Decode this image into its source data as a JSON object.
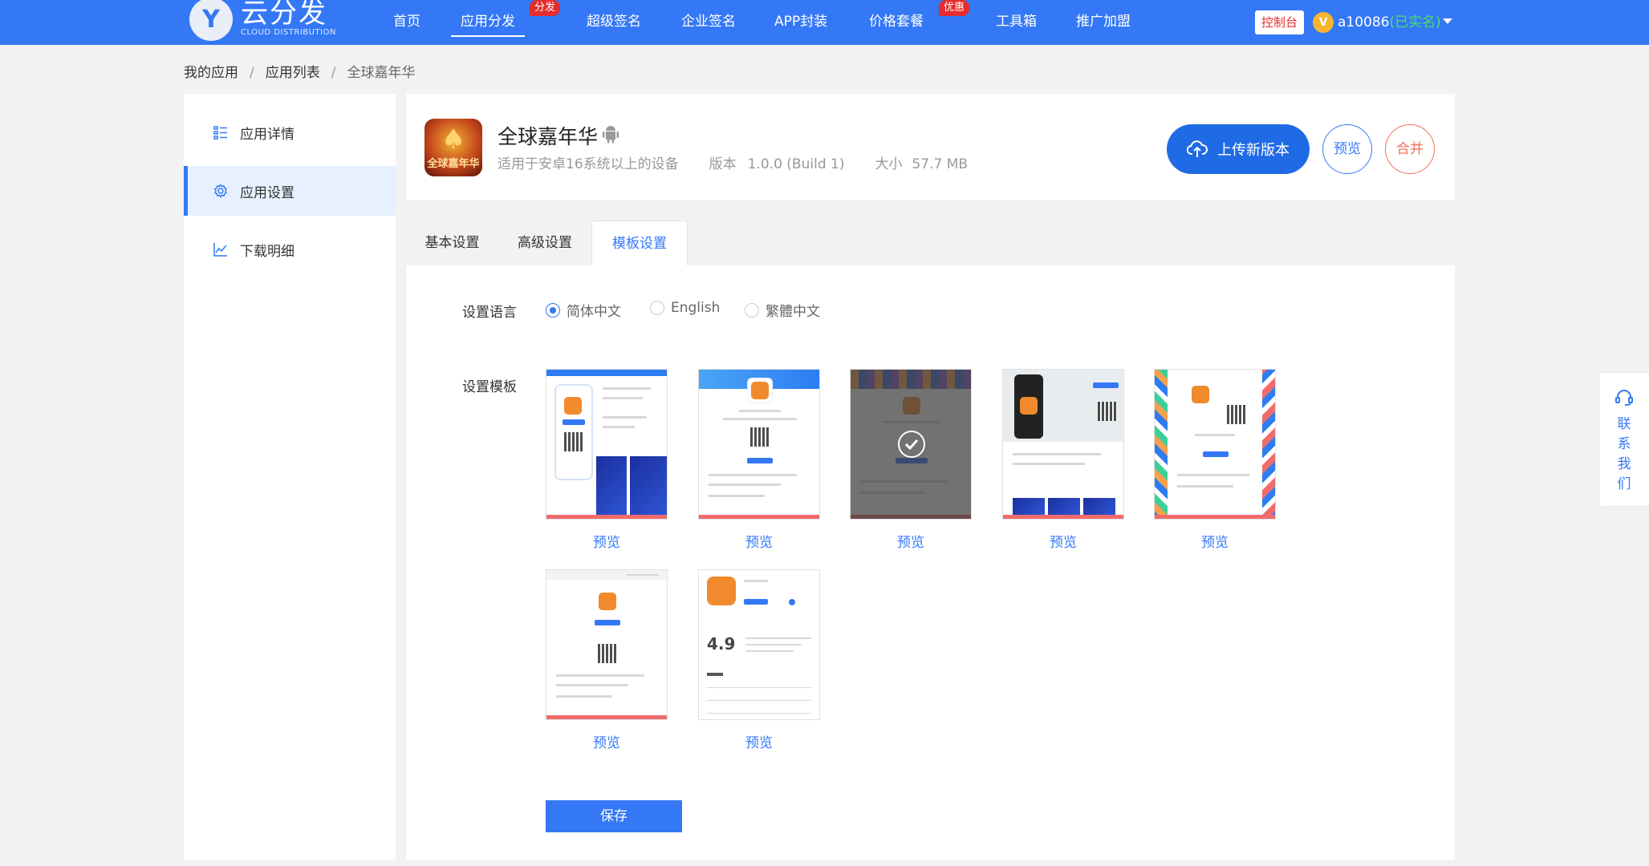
{
  "brand": {
    "logo_letter": "Y",
    "name_cn": "云分发",
    "name_en": "CLOUD DISTRIBUTION"
  },
  "nav": {
    "items": [
      "首页",
      "应用分发",
      "超级签名",
      "企业签名",
      "APP封装",
      "价格套餐",
      "工具箱",
      "推广加盟"
    ],
    "badge_distribute": "分发",
    "badge_price": "优惠",
    "active": "应用分发"
  },
  "user": {
    "console_label": "控制台",
    "vip_letter": "V",
    "name": "a10086",
    "status": "(已实名)"
  },
  "breadcrumb": {
    "root": "我的应用",
    "list": "应用列表",
    "current": "全球嘉年华",
    "sep": "/"
  },
  "sidebar": {
    "items": [
      "应用详情",
      "应用设置",
      "下载明细"
    ],
    "active": "应用设置"
  },
  "app": {
    "name": "全球嘉年华",
    "icon_text": "全球嘉年华",
    "icon_glyph": "♠",
    "compat": "适用于安卓16系统以上的设备",
    "version_label": "版本",
    "version": "1.0.0 (Build 1)",
    "size_label": "大小",
    "size": "57.7 MB",
    "upload_label": "上传新版本",
    "preview_label": "预览",
    "merge_label": "合并"
  },
  "tabs": [
    "基本设置",
    "高级设置",
    "模板设置"
  ],
  "tabs_active": "模板设置",
  "settings": {
    "language_label": "设置语言",
    "languages": [
      "简体中文",
      "English",
      "繁體中文"
    ],
    "language_selected": "简体中文",
    "template_label": "设置模板",
    "preview_link": "预览",
    "template_count": 7,
    "template_selected_index": 3,
    "save_label": "保存"
  },
  "contact": {
    "label": "联系我们"
  },
  "colors": {
    "primary": "#3478f6",
    "danger": "#e62d2d",
    "merge": "#f06c55",
    "verified": "#4dde6b"
  }
}
